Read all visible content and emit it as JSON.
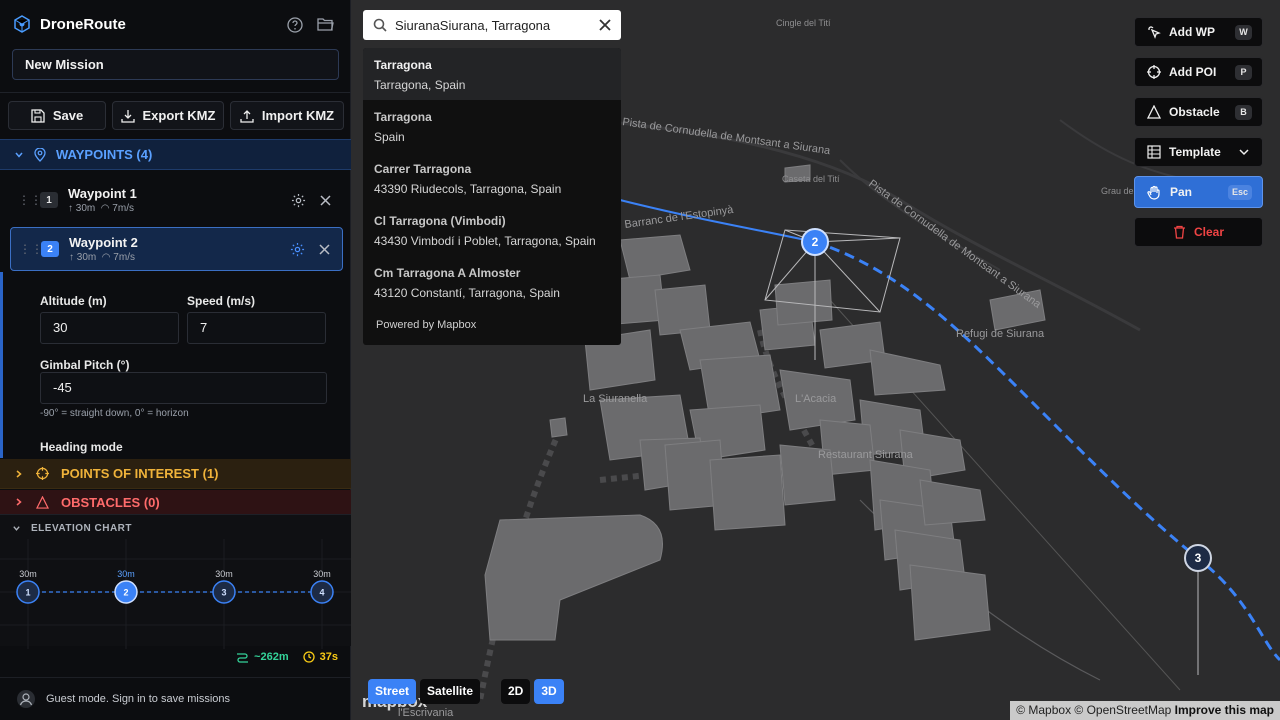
{
  "app": {
    "name": "DroneRoute"
  },
  "mission": {
    "name": "New Mission"
  },
  "toolbar": {
    "save": "Save",
    "export": "Export KMZ",
    "import": "Import KMZ"
  },
  "sections": {
    "waypoints": "WAYPOINTS (4)",
    "poi": "POINTS OF INTEREST (1)",
    "obstacles": "OBSTACLES (0)"
  },
  "waypoints": [
    {
      "num": "1",
      "name": "Waypoint 1",
      "alt": "30m",
      "speed": "7m/s"
    },
    {
      "num": "2",
      "name": "Waypoint 2",
      "alt": "30m",
      "speed": "7m/s"
    }
  ],
  "detail": {
    "altitude_label": "Altitude (m)",
    "altitude": "30",
    "speed_label": "Speed (m/s)",
    "speed": "7",
    "gimbal_label": "Gimbal Pitch (°)",
    "gimbal": "-45",
    "gimbal_hint": "-90° = straight down, 0° = horizon",
    "heading_label": "Heading mode"
  },
  "elevation": {
    "title": "ELEVATION CHART",
    "points": [
      {
        "num": "1",
        "alt": "30m"
      },
      {
        "num": "2",
        "alt": "30m"
      },
      {
        "num": "3",
        "alt": "30m"
      },
      {
        "num": "4",
        "alt": "30m"
      }
    ]
  },
  "stats": {
    "distance": "~262m",
    "time": "37s"
  },
  "footer": {
    "guest": "Guest mode. Sign in to save missions"
  },
  "search": {
    "query": "SiuranaSiurana, Tarragona",
    "results": [
      {
        "title": "Tarragona",
        "sub": "Tarragona, Spain"
      },
      {
        "title": "Tarragona",
        "sub": "Spain"
      },
      {
        "title": "Carrer Tarragona",
        "sub": "43390 Riudecols, Tarragona, Spain"
      },
      {
        "title": "Cl Tarragona (Vimbodi)",
        "sub": "43430 Vimbodí i Poblet, Tarragona, Spain"
      },
      {
        "title": "Cm Tarragona A Almoster",
        "sub": "43120 Constantí, Tarragona, Spain"
      }
    ],
    "powered": "Powered by Mapbox"
  },
  "tools": [
    {
      "label": "Add WP",
      "key": "W"
    },
    {
      "label": "Add POI",
      "key": "P"
    },
    {
      "label": "Obstacle",
      "key": "B"
    },
    {
      "label": "Template",
      "key": ""
    },
    {
      "label": "Pan",
      "key": "Esc"
    },
    {
      "label": "Clear",
      "key": ""
    }
  ],
  "map_style": {
    "street": "Street",
    "satellite": "Satellite",
    "d2": "2D",
    "d3": "3D"
  },
  "map_labels": {
    "l1": "Cingle del Tití",
    "l2": "Caseta del Tití",
    "l3": "Refugi de Siurana",
    "l4": "La Siuranella",
    "l5": "L'Acacia",
    "l6": "Restaurant Siurana",
    "l7": "Grau del",
    "l8": "l'Escrivania",
    "road1": "Pista de Cornudella de Montsant a Siurana",
    "road2": "Pista de Cornudella de Montsant a Siurana",
    "road3": "Barranc de l'Estopinyà",
    "wp2": "2",
    "wp3": "3"
  },
  "mapbox_logo": "mapbox",
  "attribution": {
    "text": "© Mapbox © OpenStreetMap",
    "link": "Improve this map"
  },
  "colors": {
    "accent": "#3b82f6",
    "poi": "#f0b33a",
    "obstacle": "#ef4444"
  }
}
